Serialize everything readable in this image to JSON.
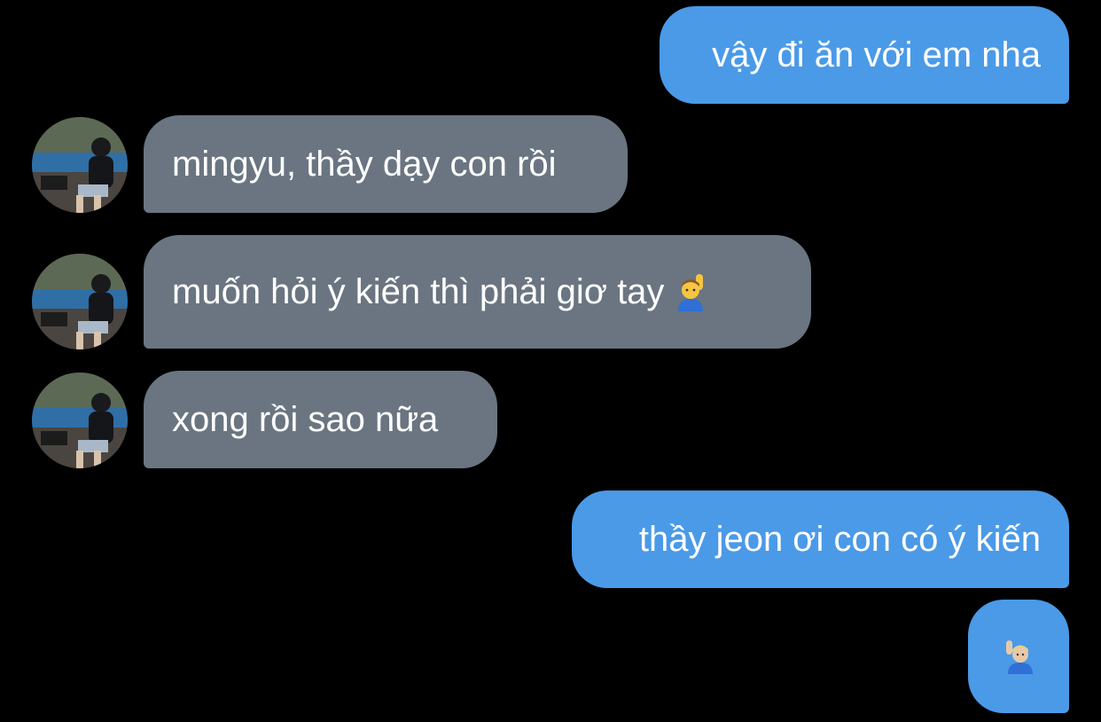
{
  "chat": {
    "messages": [
      {
        "direction": "outgoing",
        "text": "vậy đi ăn với em nha"
      },
      {
        "direction": "incoming",
        "text": "mingyu, thầy dạy con rồi"
      },
      {
        "direction": "incoming",
        "text": "muốn hỏi ý kiến thì phải giơ tay"
      },
      {
        "direction": "incoming",
        "text": "xong rồi sao nữa"
      },
      {
        "direction": "outgoing",
        "text": "thầy jeon ơi con có ý kiến"
      },
      {
        "direction": "outgoing",
        "text": ""
      }
    ],
    "emojis": {
      "raising_hand_man": "raising-hand-man-emoji",
      "raising_hand_man_light": "raising-hand-man-light-emoji"
    }
  },
  "colors": {
    "background": "#000000",
    "outgoing_bubble": "#4a9ae8",
    "incoming_bubble": "#6a7581",
    "text": "#ffffff"
  }
}
